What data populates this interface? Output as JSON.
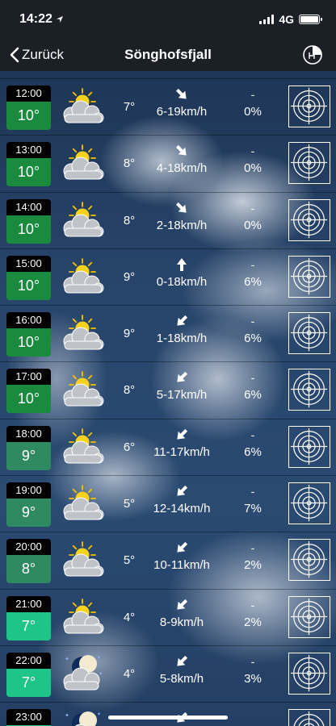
{
  "status": {
    "time": "14:22",
    "network": "4G"
  },
  "nav": {
    "back_label": "Zurück",
    "title": "Sönghofsfjall"
  },
  "rows": [
    {
      "time": "12:00",
      "temp": "10°",
      "low": "7°",
      "wind": "6-19km/h",
      "precip": "-",
      "pct": "0%",
      "wind_angle": 135,
      "icon": "partly-sunny-icon",
      "color": "#1a8a3e"
    },
    {
      "time": "13:00",
      "temp": "10°",
      "low": "8°",
      "wind": "4-18km/h",
      "precip": "-",
      "pct": "0%",
      "wind_angle": 135,
      "icon": "partly-sunny-icon",
      "color": "#1a8a3e"
    },
    {
      "time": "14:00",
      "temp": "10°",
      "low": "8°",
      "wind": "2-18km/h",
      "precip": "-",
      "pct": "0%",
      "wind_angle": 135,
      "icon": "partly-sunny-icon",
      "color": "#1a8a3e"
    },
    {
      "time": "15:00",
      "temp": "10°",
      "low": "9°",
      "wind": "0-18km/h",
      "precip": "-",
      "pct": "6%",
      "wind_angle": 0,
      "icon": "partly-sunny-icon",
      "color": "#1a8a3e"
    },
    {
      "time": "16:00",
      "temp": "10°",
      "low": "9°",
      "wind": "1-18km/h",
      "precip": "-",
      "pct": "6%",
      "wind_angle": 225,
      "icon": "partly-sunny-icon",
      "color": "#1a8a3e"
    },
    {
      "time": "17:00",
      "temp": "10°",
      "low": "8°",
      "wind": "5-17km/h",
      "precip": "-",
      "pct": "6%",
      "wind_angle": 225,
      "icon": "partly-sunny-icon",
      "color": "#1a8a3e"
    },
    {
      "time": "18:00",
      "temp": "9°",
      "low": "6°",
      "wind": "11-17km/h",
      "precip": "-",
      "pct": "6%",
      "wind_angle": 225,
      "icon": "partly-sunny-icon",
      "color": "#2f8a62"
    },
    {
      "time": "19:00",
      "temp": "9°",
      "low": "5°",
      "wind": "12-14km/h",
      "precip": "-",
      "pct": "7%",
      "wind_angle": 225,
      "icon": "partly-sunny-icon",
      "color": "#2f8a62"
    },
    {
      "time": "20:00",
      "temp": "8°",
      "low": "5°",
      "wind": "10-11km/h",
      "precip": "-",
      "pct": "2%",
      "wind_angle": 225,
      "icon": "partly-sunny-icon",
      "color": "#2f8a62"
    },
    {
      "time": "21:00",
      "temp": "7°",
      "low": "4°",
      "wind": "8-9km/h",
      "precip": "-",
      "pct": "2%",
      "wind_angle": 225,
      "icon": "partly-sunny-icon",
      "color": "#1fc488"
    },
    {
      "time": "22:00",
      "temp": "7°",
      "low": "4°",
      "wind": "5-8km/h",
      "precip": "-",
      "pct": "3%",
      "wind_angle": 225,
      "icon": "partly-cloudy-night-icon",
      "color": "#1fc488"
    },
    {
      "time": "23:00",
      "temp": "",
      "low": "",
      "wind": "",
      "precip": "",
      "pct": "",
      "wind_angle": 225,
      "icon": "partly-cloudy-night-icon",
      "color": "#1fc488"
    }
  ]
}
